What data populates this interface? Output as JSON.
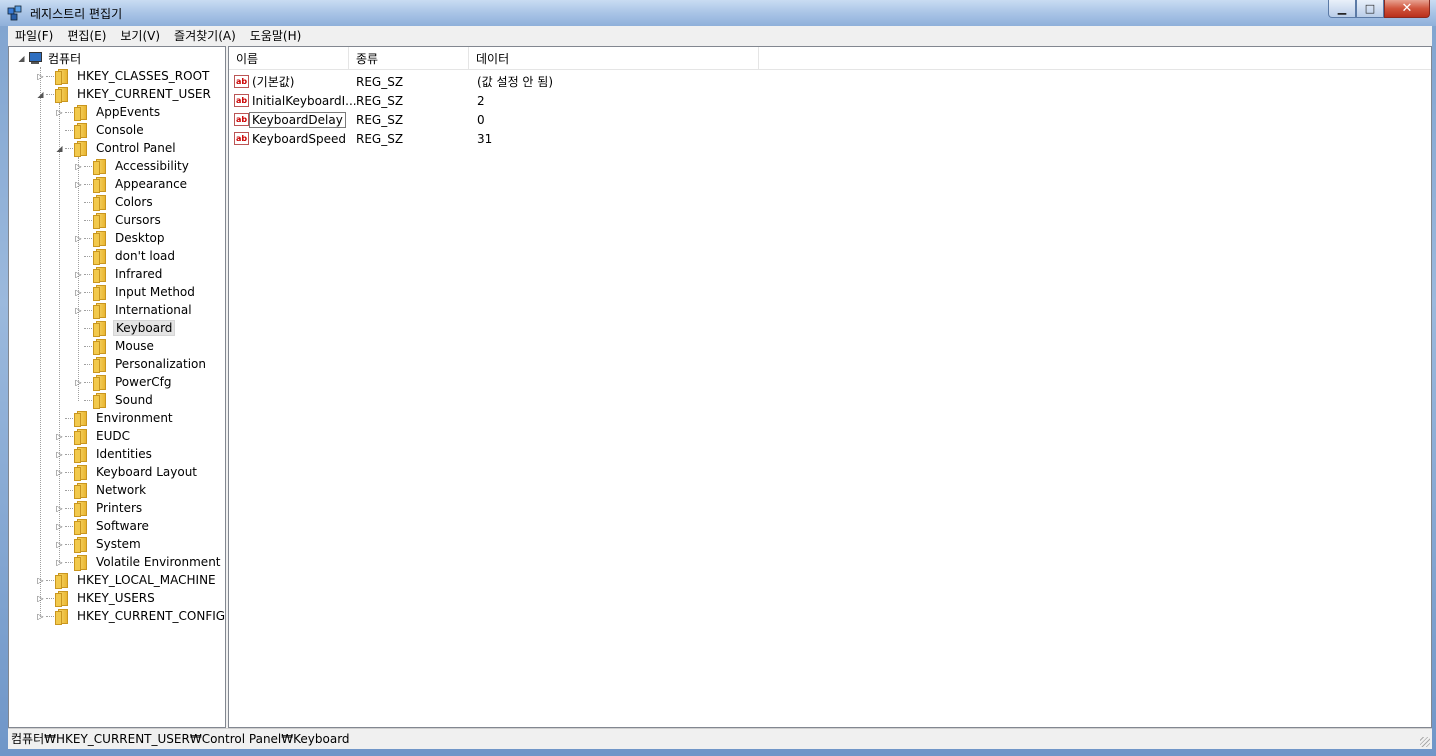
{
  "window": {
    "title": "레지스트리 편집기"
  },
  "menu": [
    "파일(F)",
    "편집(E)",
    "보기(V)",
    "즐겨찾기(A)",
    "도움말(H)"
  ],
  "tree": {
    "root": "컴퓨터",
    "hives": [
      "HKEY_CLASSES_ROOT",
      "HKEY_CURRENT_USER",
      "HKEY_LOCAL_MACHINE",
      "HKEY_USERS",
      "HKEY_CURRENT_CONFIG"
    ],
    "hkcu_children": [
      "AppEvents",
      "Console",
      "Control Panel",
      "Environment",
      "EUDC",
      "Identities",
      "Keyboard Layout",
      "Network",
      "Printers",
      "Software",
      "System",
      "Volatile Environment"
    ],
    "control_panel_children": [
      "Accessibility",
      "Appearance",
      "Colors",
      "Cursors",
      "Desktop",
      "don't load",
      "Infrared",
      "Input Method",
      "International",
      "Keyboard",
      "Mouse",
      "Personalization",
      "PowerCfg",
      "Sound"
    ],
    "selected": "Keyboard"
  },
  "list": {
    "columns": [
      "이름",
      "종류",
      "데이터"
    ],
    "rows": [
      {
        "name": "(기본값)",
        "type": "REG_SZ",
        "data": "(값 설정 안 됨)"
      },
      {
        "name": "InitialKeyboardI...",
        "type": "REG_SZ",
        "data": "2"
      },
      {
        "name": "KeyboardDelay",
        "type": "REG_SZ",
        "data": "0"
      },
      {
        "name": "KeyboardSpeed",
        "type": "REG_SZ",
        "data": "31"
      }
    ]
  },
  "status": {
    "path": "컴퓨터₩HKEY_CURRENT_USER₩Control Panel₩Keyboard"
  },
  "colors": {
    "title_gradient": "#a9c4e6",
    "close_button": "#d0543c",
    "folder": "#f2c94c"
  },
  "icons": {
    "value": "string-value-icon",
    "key": "folder-icon",
    "root": "computer-icon"
  }
}
